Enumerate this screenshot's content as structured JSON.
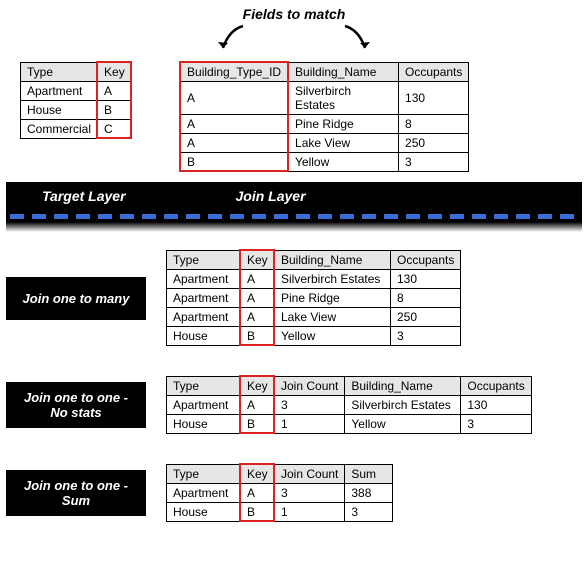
{
  "header_label": "Fields to match",
  "bar": {
    "target": "Target Layer",
    "join": "Join Layer"
  },
  "target_table": {
    "headers": [
      "Type",
      "Key"
    ],
    "rows": [
      [
        "Apartment",
        "A"
      ],
      [
        "House",
        "B"
      ],
      [
        "Commercial",
        "C"
      ]
    ]
  },
  "join_table": {
    "headers": [
      "Building_Type_ID",
      "Building_Name",
      "Occupants"
    ],
    "rows": [
      [
        "A",
        "Silverbirch Estates",
        "130"
      ],
      [
        "A",
        "Pine Ridge",
        "8"
      ],
      [
        "A",
        "Lake View",
        "250"
      ],
      [
        "B",
        "Yellow",
        "3"
      ]
    ]
  },
  "result1": {
    "label": "Join one to many",
    "headers": [
      "Type",
      "Key",
      "Building_Name",
      "Occupants"
    ],
    "rows": [
      [
        "Apartment",
        "A",
        "Silverbirch Estates",
        "130"
      ],
      [
        "Apartment",
        "A",
        "Pine Ridge",
        "8"
      ],
      [
        "Apartment",
        "A",
        "Lake View",
        "250"
      ],
      [
        "House",
        "B",
        "Yellow",
        "3"
      ]
    ]
  },
  "result2": {
    "label_l1": "Join one to one -",
    "label_l2": "No stats",
    "headers": [
      "Type",
      "Key",
      "Join Count",
      "Building_Name",
      "Occupants"
    ],
    "rows": [
      [
        "Apartment",
        "A",
        "3",
        "Silverbirch Estates",
        "130"
      ],
      [
        "House",
        "B",
        "1",
        "Yellow",
        "3"
      ]
    ]
  },
  "result3": {
    "label_l1": "Join one to one -",
    "label_l2": "Sum",
    "headers": [
      "Type",
      "Key",
      "Join Count",
      "Sum"
    ],
    "rows": [
      [
        "Apartment",
        "A",
        "3",
        "388"
      ],
      [
        "House",
        "B",
        "1",
        "3"
      ]
    ]
  },
  "chart_data": {
    "type": "table",
    "description": "Spatial join operation diagram showing join field matching",
    "target_layer_key_field": "Key",
    "join_layer_key_field": "Building_Type_ID",
    "join_operations": [
      "one_to_many",
      "one_to_one_no_stats",
      "one_to_one_sum"
    ]
  }
}
